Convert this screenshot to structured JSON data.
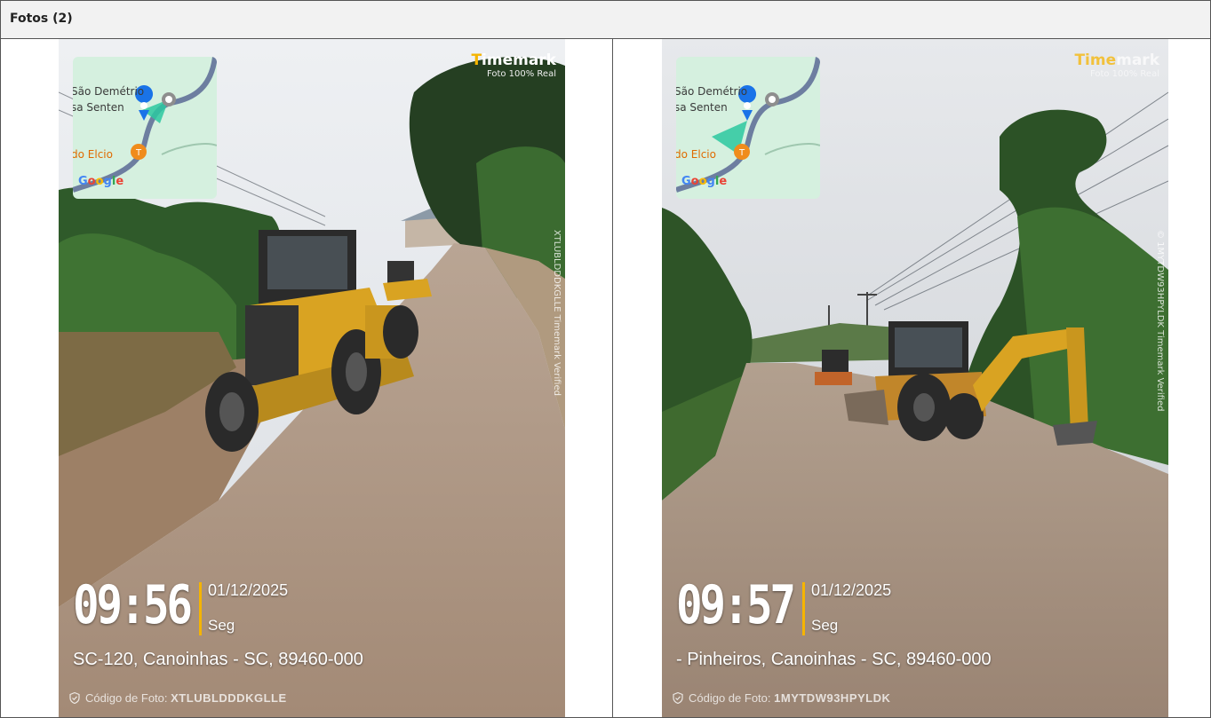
{
  "panel": {
    "title": "Fotos (2)"
  },
  "photos": [
    {
      "map": {
        "labels": [
          "São Demétrio",
          "sa Senten",
          "do Elcio"
        ],
        "google": "Google"
      },
      "brand": {
        "name_prefix": "T",
        "name_rest": "imemark",
        "tagline": "Foto 100% Real"
      },
      "vertical_text": "XTLUBLDDDKGLLE  Timemark Verified",
      "time": "09:56",
      "date": "01/12/2025",
      "weekday": "Seg",
      "address": "SC-120, Canoinhas - SC, 89460-000",
      "code_label": "Código de Foto:",
      "code_value": "XTLUBLDDDKGLLE"
    },
    {
      "map": {
        "labels": [
          "São Demétrio",
          "sa Senten",
          "do Elcio"
        ],
        "google": "Google"
      },
      "brand": {
        "name_prefix": "Time",
        "name_rest": "mark",
        "tagline": "Foto 100% Real"
      },
      "vertical_text": "© 1MYTDW93HPYLDK  Timemark Verified",
      "time": "09:57",
      "date": "01/12/2025",
      "weekday": "Seg",
      "address": "- Pinheiros, Canoinhas - SC, 89460-000",
      "code_label": "Código de Foto:",
      "code_value": "1MYTDW93HPYLDK"
    }
  ]
}
